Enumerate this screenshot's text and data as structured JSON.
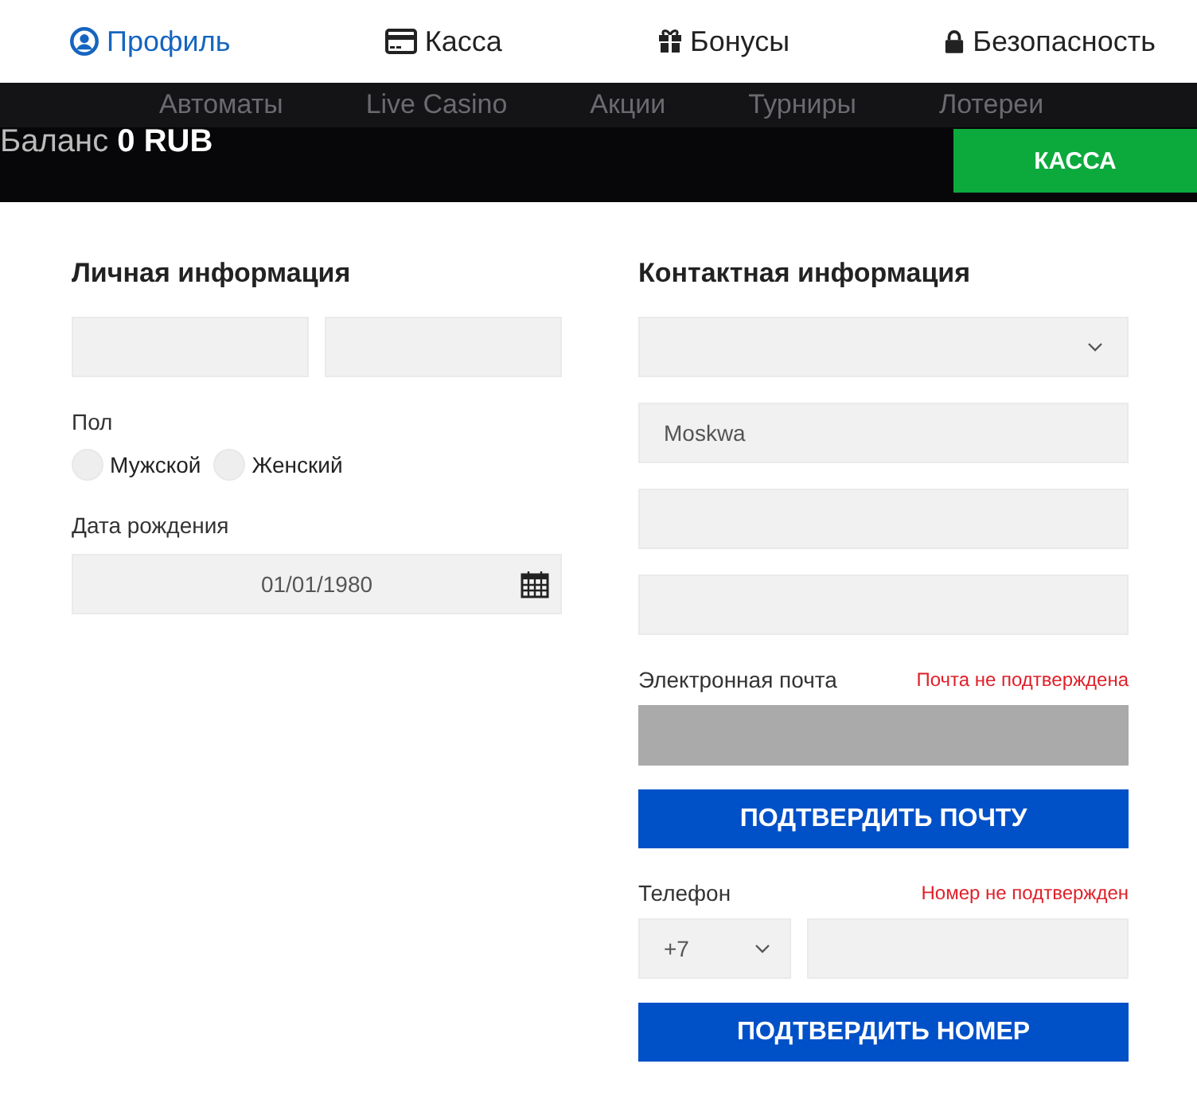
{
  "tabs": [
    {
      "label": "Профиль",
      "selected": true
    },
    {
      "label": "Касса",
      "selected": false
    },
    {
      "label": "Бонусы",
      "selected": false
    },
    {
      "label": "Безопасность",
      "selected": false
    }
  ],
  "nav": [
    "Автоматы",
    "Live Casino",
    "Акции",
    "Турниры",
    "Лотереи"
  ],
  "balance": {
    "label": "Баланс",
    "amount": "0 RUB"
  },
  "cashier_button": "КАССА",
  "personal": {
    "title": "Личная информация",
    "gender": {
      "label": "Пол",
      "options": [
        {
          "label": "Мужской",
          "selected": false
        },
        {
          "label": "Женский",
          "selected": false
        }
      ]
    },
    "birth_date": {
      "label": "Дата рождения",
      "value": "01/01/1980"
    }
  },
  "contact": {
    "title": "Контактная информация",
    "city": "Moskwa",
    "email": {
      "label": "Электронная почта",
      "status": "Почта не подтверждена",
      "disabled": true,
      "button": "ПОДТВЕРДИТЬ ПОЧТУ"
    },
    "phone": {
      "label": "Телефон",
      "status": "Номер не подтвержден",
      "code": "+7",
      "button": "ПОДТВЕРДИТЬ НОМЕР"
    }
  }
}
